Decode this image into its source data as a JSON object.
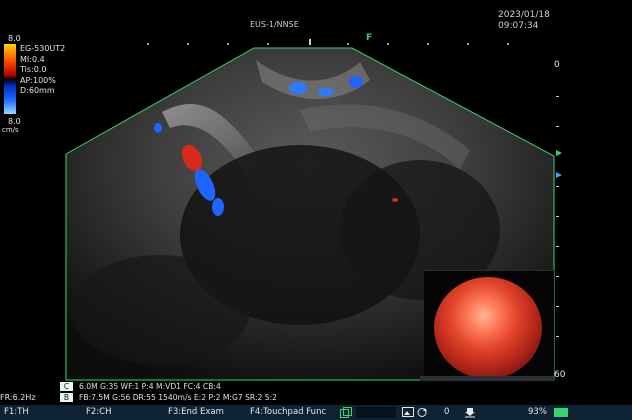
{
  "header": {
    "title": "EUS-1/NNSE",
    "date": "2023/01/18",
    "time": "09:07:34"
  },
  "side_params": {
    "scale_top": "8.0",
    "probe": "EG-530UT2",
    "mi": "MI:0.4",
    "tis": "Tis:0.0",
    "ap": "AP:100%",
    "depth": "D:60mm",
    "scale_bottom": "8.0",
    "scale_unit": "cm/s"
  },
  "depth_scale": {
    "top": "0",
    "bottom": "60"
  },
  "markers": {
    "focus": "F"
  },
  "status": {
    "frame_rate": "FR:6.2Hz",
    "row_c": {
      "label": "C",
      "text": "6.0M  G:35  WF:1 P:4 M:VD1 FC:4 CB:4"
    },
    "row_b": {
      "label": "B",
      "text": "FB:7.5M  G:56  DR:55  1540m/s  E:2 P:2 M:G7  SR:2 S:2"
    }
  },
  "function_keys": [
    {
      "label": "F1:TH"
    },
    {
      "label": "F2:CH"
    },
    {
      "label": "F3:End Exam"
    },
    {
      "label": "F4:Touchpad Func"
    }
  ],
  "bottom_bar": {
    "counter": "0",
    "zoom": "93%"
  },
  "colors": {
    "sector_outline": "#37d46b",
    "doppler_red": "#d62a1a",
    "doppler_blue": "#1f64ff",
    "function_bar": "#0d2232"
  }
}
